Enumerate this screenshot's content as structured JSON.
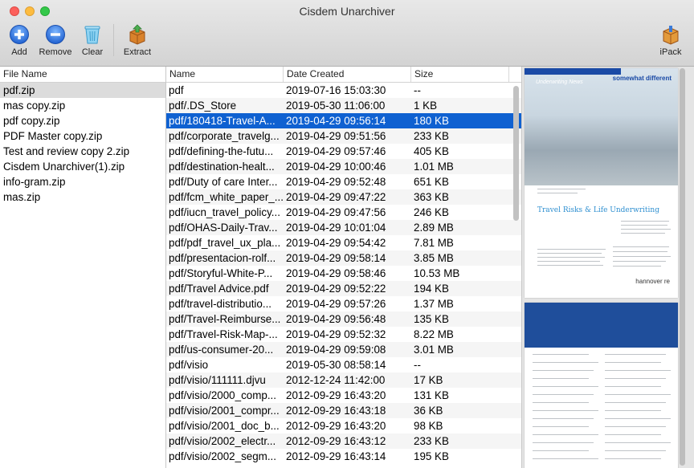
{
  "window": {
    "title": "Cisdem Unarchiver"
  },
  "toolbar": {
    "add_label": "Add",
    "remove_label": "Remove",
    "clear_label": "Clear",
    "extract_label": "Extract",
    "ipack_label": "iPack"
  },
  "archives": {
    "header": "File Name",
    "items": [
      "pdf.zip",
      "mas copy.zip",
      "pdf copy.zip",
      "PDF Master copy.zip",
      "Test and review copy 2.zip",
      "Cisdem Unarchiver(1).zip",
      "info-gram.zip",
      "mas.zip"
    ],
    "selected_index": 0
  },
  "contents": {
    "headers": {
      "name": "Name",
      "date": "Date Created",
      "size": "Size"
    },
    "selected_index": 2,
    "rows": [
      {
        "name": "pdf",
        "date": "2019-07-16 15:03:30",
        "size": "--"
      },
      {
        "name": "pdf/.DS_Store",
        "date": "2019-05-30 11:06:00",
        "size": "1 KB"
      },
      {
        "name": "pdf/180418-Travel-A...",
        "date": "2019-04-29 09:56:14",
        "size": "180 KB"
      },
      {
        "name": "pdf/corporate_travelg...",
        "date": "2019-04-29 09:51:56",
        "size": "233 KB"
      },
      {
        "name": "pdf/defining-the-futu...",
        "date": "2019-04-29 09:57:46",
        "size": "405 KB"
      },
      {
        "name": "pdf/destination-healt...",
        "date": "2019-04-29 10:00:46",
        "size": "1.01 MB"
      },
      {
        "name": "pdf/Duty of care Inter...",
        "date": "2019-04-29 09:52:48",
        "size": "651 KB"
      },
      {
        "name": "pdf/fcm_white_paper_...",
        "date": "2019-04-29 09:47:22",
        "size": "363 KB"
      },
      {
        "name": "pdf/iucn_travel_policy...",
        "date": "2019-04-29 09:47:56",
        "size": "246 KB"
      },
      {
        "name": "pdf/OHAS-Daily-Trav...",
        "date": "2019-04-29 10:01:04",
        "size": "2.89 MB"
      },
      {
        "name": "pdf/pdf_travel_ux_pla...",
        "date": "2019-04-29 09:54:42",
        "size": "7.81 MB"
      },
      {
        "name": "pdf/presentacion-rolf...",
        "date": "2019-04-29 09:58:14",
        "size": "3.85 MB"
      },
      {
        "name": "pdf/Storyful-White-P...",
        "date": "2019-04-29 09:58:46",
        "size": "10.53 MB"
      },
      {
        "name": "pdf/Travel Advice.pdf",
        "date": "2019-04-29 09:52:22",
        "size": "194 KB"
      },
      {
        "name": "pdf/travel-distributio...",
        "date": "2019-04-29 09:57:26",
        "size": "1.37 MB"
      },
      {
        "name": "pdf/Travel-Reimburse...",
        "date": "2019-04-29 09:56:48",
        "size": "135 KB"
      },
      {
        "name": "pdf/Travel-Risk-Map-...",
        "date": "2019-04-29 09:52:32",
        "size": "8.22 MB"
      },
      {
        "name": "pdf/us-consumer-20...",
        "date": "2019-04-29 09:59:08",
        "size": "3.01 MB"
      },
      {
        "name": "pdf/visio",
        "date": "2019-05-30 08:58:14",
        "size": "--"
      },
      {
        "name": "pdf/visio/111111.djvu",
        "date": "2012-12-24 11:42:00",
        "size": "17 KB"
      },
      {
        "name": "pdf/visio/2000_comp...",
        "date": "2012-09-29 16:43:20",
        "size": "131 KB"
      },
      {
        "name": "pdf/visio/2001_compr...",
        "date": "2012-09-29 16:43:18",
        "size": "36 KB"
      },
      {
        "name": "pdf/visio/2001_doc_b...",
        "date": "2012-09-29 16:43:20",
        "size": "98 KB"
      },
      {
        "name": "pdf/visio/2002_electr...",
        "date": "2012-09-29 16:43:12",
        "size": "233 KB"
      },
      {
        "name": "pdf/visio/2002_segm...",
        "date": "2012-09-29 16:43:14",
        "size": "195 KB"
      }
    ]
  },
  "preview": {
    "page1": {
      "heading": "Underwriting News",
      "brand": "somewhat different",
      "title": "Travel Risks & Life Underwriting",
      "footer": "hannover re"
    }
  },
  "colors": {
    "selection_blue": "#0f61d1",
    "add_icon": "#2f7de1",
    "remove_icon": "#2f7de1",
    "clear_icon": "#5cb8e6",
    "extract_icon": "#d9822b"
  }
}
